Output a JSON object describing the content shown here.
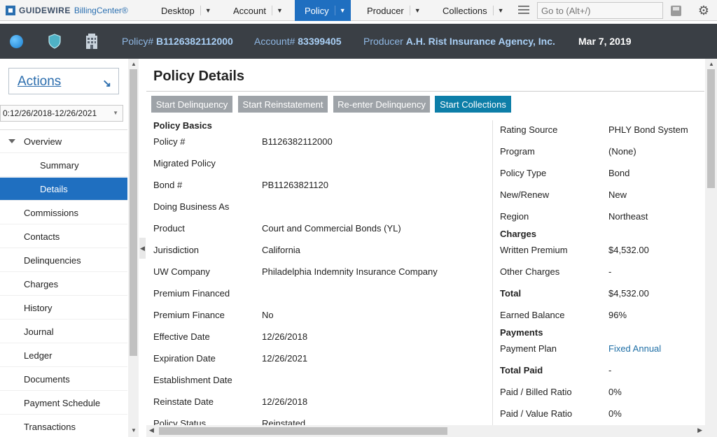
{
  "logo": {
    "brand": "GUIDEWIRE",
    "product": "BillingCenter®"
  },
  "topnav": {
    "tabs": [
      {
        "label": "Desktop",
        "active": false
      },
      {
        "label": "Account",
        "active": false
      },
      {
        "label": "Policy",
        "active": true
      },
      {
        "label": "Producer",
        "active": false
      },
      {
        "label": "Collections",
        "active": false
      }
    ],
    "goto_placeholder": "Go to (Alt+/)"
  },
  "infobar": {
    "policy_label": "Policy#",
    "policy_value": "B1126382112000",
    "account_label": "Account#",
    "account_value": "83399405",
    "producer_label": "Producer",
    "producer_value": "A.H. Rist Insurance Agency, Inc.",
    "date": "Mar 7, 2019"
  },
  "sidebar": {
    "actions_label": "Actions",
    "period": "0:12/26/2018-12/26/2021",
    "items": [
      {
        "label": "Overview",
        "level": 0,
        "expandable": true,
        "selected": false
      },
      {
        "label": "Summary",
        "level": 1,
        "selected": false
      },
      {
        "label": "Details",
        "level": 1,
        "selected": true
      },
      {
        "label": "Commissions",
        "level": 0,
        "selected": false
      },
      {
        "label": "Contacts",
        "level": 0,
        "selected": false
      },
      {
        "label": "Delinquencies",
        "level": 0,
        "selected": false
      },
      {
        "label": "Charges",
        "level": 0,
        "selected": false
      },
      {
        "label": "History",
        "level": 0,
        "selected": false
      },
      {
        "label": "Journal",
        "level": 0,
        "selected": false
      },
      {
        "label": "Ledger",
        "level": 0,
        "selected": false
      },
      {
        "label": "Documents",
        "level": 0,
        "selected": false
      },
      {
        "label": "Payment Schedule",
        "level": 0,
        "selected": false
      },
      {
        "label": "Transactions",
        "level": 0,
        "selected": false
      }
    ]
  },
  "main": {
    "title": "Policy Details",
    "buttons": [
      {
        "label": "Start Delinquency",
        "enabled": false
      },
      {
        "label": "Start Reinstatement",
        "enabled": false
      },
      {
        "label": "Re-enter Delinquency",
        "enabled": false
      },
      {
        "label": "Start Collections",
        "enabled": true
      }
    ],
    "left": {
      "section": "Policy Basics",
      "rows": [
        {
          "label": "Policy #",
          "value": "B1126382112000"
        },
        {
          "label": "Migrated Policy",
          "value": ""
        },
        {
          "label": "Bond #",
          "value": "PB11263821120"
        },
        {
          "label": "Doing Business As",
          "value": ""
        },
        {
          "label": "Product",
          "value": "Court and Commercial Bonds (YL)"
        },
        {
          "label": "Jurisdiction",
          "value": "California"
        },
        {
          "label": "UW Company",
          "value": "Philadelphia Indemnity Insurance Company"
        },
        {
          "label": "Premium Financed",
          "value": ""
        },
        {
          "label": "Premium Finance",
          "value": "No"
        },
        {
          "label": "Effective Date",
          "value": "12/26/2018"
        },
        {
          "label": "Expiration Date",
          "value": "12/26/2021"
        },
        {
          "label": "Establishment Date",
          "value": ""
        },
        {
          "label": "Reinstate Date",
          "value": "12/26/2018"
        },
        {
          "label": "Policy Status",
          "value": "Reinstated"
        }
      ]
    },
    "right": {
      "rating_source_label": "Rating Source",
      "rating_source": "PHLY Bond System",
      "program_label": "Program",
      "program": "(None)",
      "policy_type_label": "Policy Type",
      "policy_type": "Bond",
      "new_renew_label": "New/Renew",
      "new_renew": "New",
      "region_label": "Region",
      "region": "Northeast",
      "charges_head": "Charges",
      "written_premium_label": "Written Premium",
      "written_premium": "$4,532.00",
      "other_charges_label": "Other Charges",
      "other_charges": "-",
      "total_label": "Total",
      "total": "$4,532.00",
      "earned_balance_label": "Earned Balance",
      "earned_balance": "96%",
      "payments_head": "Payments",
      "payment_plan_label": "Payment Plan",
      "payment_plan": "Fixed Annual",
      "total_paid_label": "Total Paid",
      "total_paid": "-",
      "paid_billed_label": "Paid / Billed Ratio",
      "paid_billed": "0%",
      "paid_value_label": "Paid / Value Ratio",
      "paid_value": "0%"
    }
  }
}
